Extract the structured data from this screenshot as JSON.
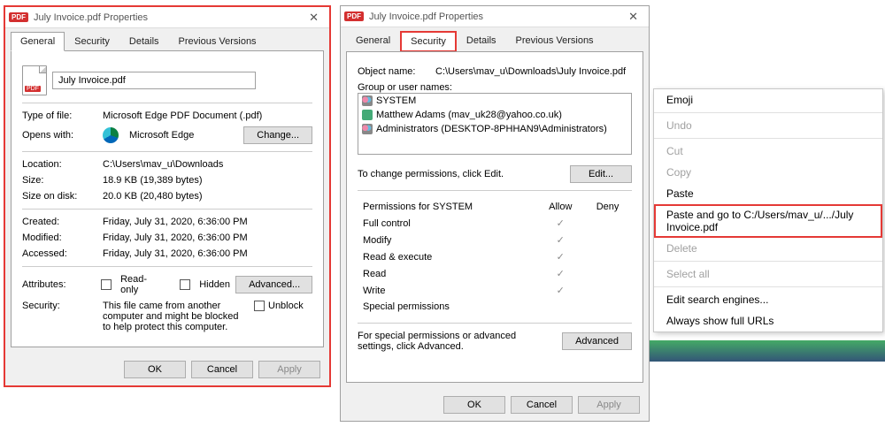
{
  "dialogA": {
    "title": "July Invoice.pdf Properties",
    "tabs": [
      "General",
      "Security",
      "Details",
      "Previous Versions"
    ],
    "activeTab": 0,
    "filename": "July Invoice.pdf",
    "typeOfFileLabel": "Type of file:",
    "typeOfFile": "Microsoft Edge PDF Document (.pdf)",
    "opensWithLabel": "Opens with:",
    "opensWith": "Microsoft Edge",
    "changeBtn": "Change...",
    "locationLabel": "Location:",
    "location": "C:\\Users\\mav_u\\Downloads",
    "sizeLabel": "Size:",
    "size": "18.9 KB (19,389 bytes)",
    "sizeOnDiskLabel": "Size on disk:",
    "sizeOnDisk": "20.0 KB (20,480 bytes)",
    "createdLabel": "Created:",
    "created": "Friday, July 31, 2020, 6:36:00 PM",
    "modifiedLabel": "Modified:",
    "modified": "Friday, July 31, 2020, 6:36:00 PM",
    "accessedLabel": "Accessed:",
    "accessed": "Friday, July 31, 2020, 6:36:00 PM",
    "attributesLabel": "Attributes:",
    "readOnly": "Read-only",
    "hidden": "Hidden",
    "advancedBtn": "Advanced...",
    "securityLabel": "Security:",
    "securityText": "This file came from another computer and might be blocked to help protect this computer.",
    "unblock": "Unblock",
    "okBtn": "OK",
    "cancelBtn": "Cancel",
    "applyBtn": "Apply"
  },
  "dialogB": {
    "title": "July Invoice.pdf Properties",
    "tabs": [
      "General",
      "Security",
      "Details",
      "Previous Versions"
    ],
    "activeTab": 1,
    "objectNameLabel": "Object name:",
    "objectName": "C:\\Users\\mav_u\\Downloads\\July Invoice.pdf",
    "groupLabel": "Group or user names:",
    "users": [
      {
        "icon": "group",
        "name": "SYSTEM"
      },
      {
        "icon": "single",
        "name": "Matthew Adams (mav_uk28@yahoo.co.uk)"
      },
      {
        "icon": "group",
        "name": "Administrators (DESKTOP-8PHHAN9\\Administrators)"
      }
    ],
    "changePermText": "To change permissions, click Edit.",
    "editBtn": "Edit...",
    "permForLabel": "Permissions for SYSTEM",
    "allowLabel": "Allow",
    "denyLabel": "Deny",
    "perms": [
      {
        "name": "Full control",
        "allow": true,
        "deny": false
      },
      {
        "name": "Modify",
        "allow": true,
        "deny": false
      },
      {
        "name": "Read & execute",
        "allow": true,
        "deny": false
      },
      {
        "name": "Read",
        "allow": true,
        "deny": false
      },
      {
        "name": "Write",
        "allow": true,
        "deny": false
      },
      {
        "name": "Special permissions",
        "allow": false,
        "deny": false
      }
    ],
    "specialText": "For special permissions or advanced settings, click Advanced.",
    "advancedBtn": "Advanced",
    "okBtn": "OK",
    "cancelBtn": "Cancel",
    "applyBtn": "Apply"
  },
  "contextMenu": {
    "items": [
      {
        "label": "Emoji",
        "type": "normal"
      },
      {
        "type": "sep"
      },
      {
        "label": "Undo",
        "type": "disabled"
      },
      {
        "type": "sep"
      },
      {
        "label": "Cut",
        "type": "disabled"
      },
      {
        "label": "Copy",
        "type": "disabled"
      },
      {
        "label": "Paste",
        "type": "normal"
      },
      {
        "label": "Paste and go to C:/Users/mav_u/.../July Invoice.pdf",
        "type": "highlight"
      },
      {
        "label": "Delete",
        "type": "disabled"
      },
      {
        "type": "sep"
      },
      {
        "label": "Select all",
        "type": "disabled"
      },
      {
        "type": "sep"
      },
      {
        "label": "Edit search engines...",
        "type": "normal"
      },
      {
        "label": "Always show full URLs",
        "type": "normal"
      }
    ]
  }
}
